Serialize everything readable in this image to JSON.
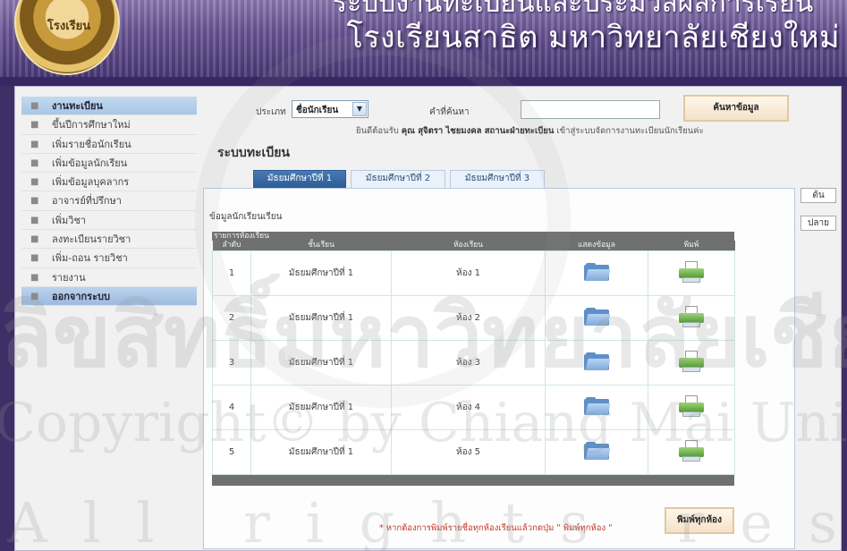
{
  "banner": {
    "logo_text": "โรงเรียน",
    "top_text": "ระบบงานทะเบียนและประมวลผลการเรียน",
    "title": "โรงเรียนสาธิต มหาวิทยาลัยเชียงใหม่"
  },
  "sidebar": {
    "items": [
      {
        "label": "งานทะเบียน"
      },
      {
        "label": "ขึ้นปีการศึกษาใหม่"
      },
      {
        "label": "เพิ่มรายชื่อนักเรียน"
      },
      {
        "label": "เพิ่มข้อมูลนักเรียน"
      },
      {
        "label": "เพิ่มข้อมูลบุคลากร"
      },
      {
        "label": "อาจารย์ที่ปรึกษา"
      },
      {
        "label": "เพิ่มวิชา"
      },
      {
        "label": "ลงทะเบียนรายวิชา"
      },
      {
        "label": "เพิ่ม-ถอน รายวิชา"
      },
      {
        "label": "รายงาน"
      },
      {
        "label": "ออกจากระบบ"
      }
    ]
  },
  "search": {
    "type_label": "ประเภท",
    "type_value": "ชื่อนักเรียน",
    "keyword_label": "คำที่ค้นหา",
    "button_label": "ค้นหาข้อมูล"
  },
  "welcome": {
    "prefix": "ยินดีต้อนรับ",
    "name": "คุณ สุจิตรา ไชยมงคล สถานะฝ่ายทะเบียน",
    "suffix": "เข้าสู่ระบบจัดการงานทะเบียนนักเรียนค่ะ"
  },
  "page_title": "ระบบทะเบียน",
  "tabs": [
    {
      "label": "มัธยมศึกษาปีที่ 1"
    },
    {
      "label": "มัธยมศึกษาปีที่ 2"
    },
    {
      "label": "มัธยมศึกษาปีที่ 3"
    }
  ],
  "nav": {
    "top": "ต้น",
    "bottom": "ปลาย"
  },
  "panel": {
    "heading": "ข้อมูลนักเรียนเรียน",
    "table_caption": "รายการห้องเรียน",
    "columns": [
      "ลำดับ",
      "ชั้นเรียน",
      "ห้องเรียน",
      "แสดงข้อมูล",
      "พิมพ์"
    ],
    "rows": [
      {
        "num": "1",
        "grade": "มัธยมศึกษาปีที่ 1",
        "room": "ห้อง 1"
      },
      {
        "num": "2",
        "grade": "มัธยมศึกษาปีที่ 1",
        "room": "ห้อง 2"
      },
      {
        "num": "3",
        "grade": "มัธยมศึกษาปีที่ 1",
        "room": "ห้อง 3"
      },
      {
        "num": "4",
        "grade": "มัธยมศึกษาปีที่ 1",
        "room": "ห้อง 4"
      },
      {
        "num": "5",
        "grade": "มัธยมศึกษาปีที่ 1",
        "room": "ห้อง 5"
      }
    ],
    "note": "* หากต้องการพิมพ์รายชื่อทุกห้องเรียนแล้วกดปุ่ม \" พิมพ์ทุกห้อง \"",
    "print_all_label": "พิมพ์ทุกห้อง"
  },
  "watermark": {
    "line1": "ลิขสิทธิ์มหาวิทยาลัยเชียงใหม่",
    "line2": "Copyright© by Chiang Mai University",
    "line3": "All rights reserved"
  }
}
